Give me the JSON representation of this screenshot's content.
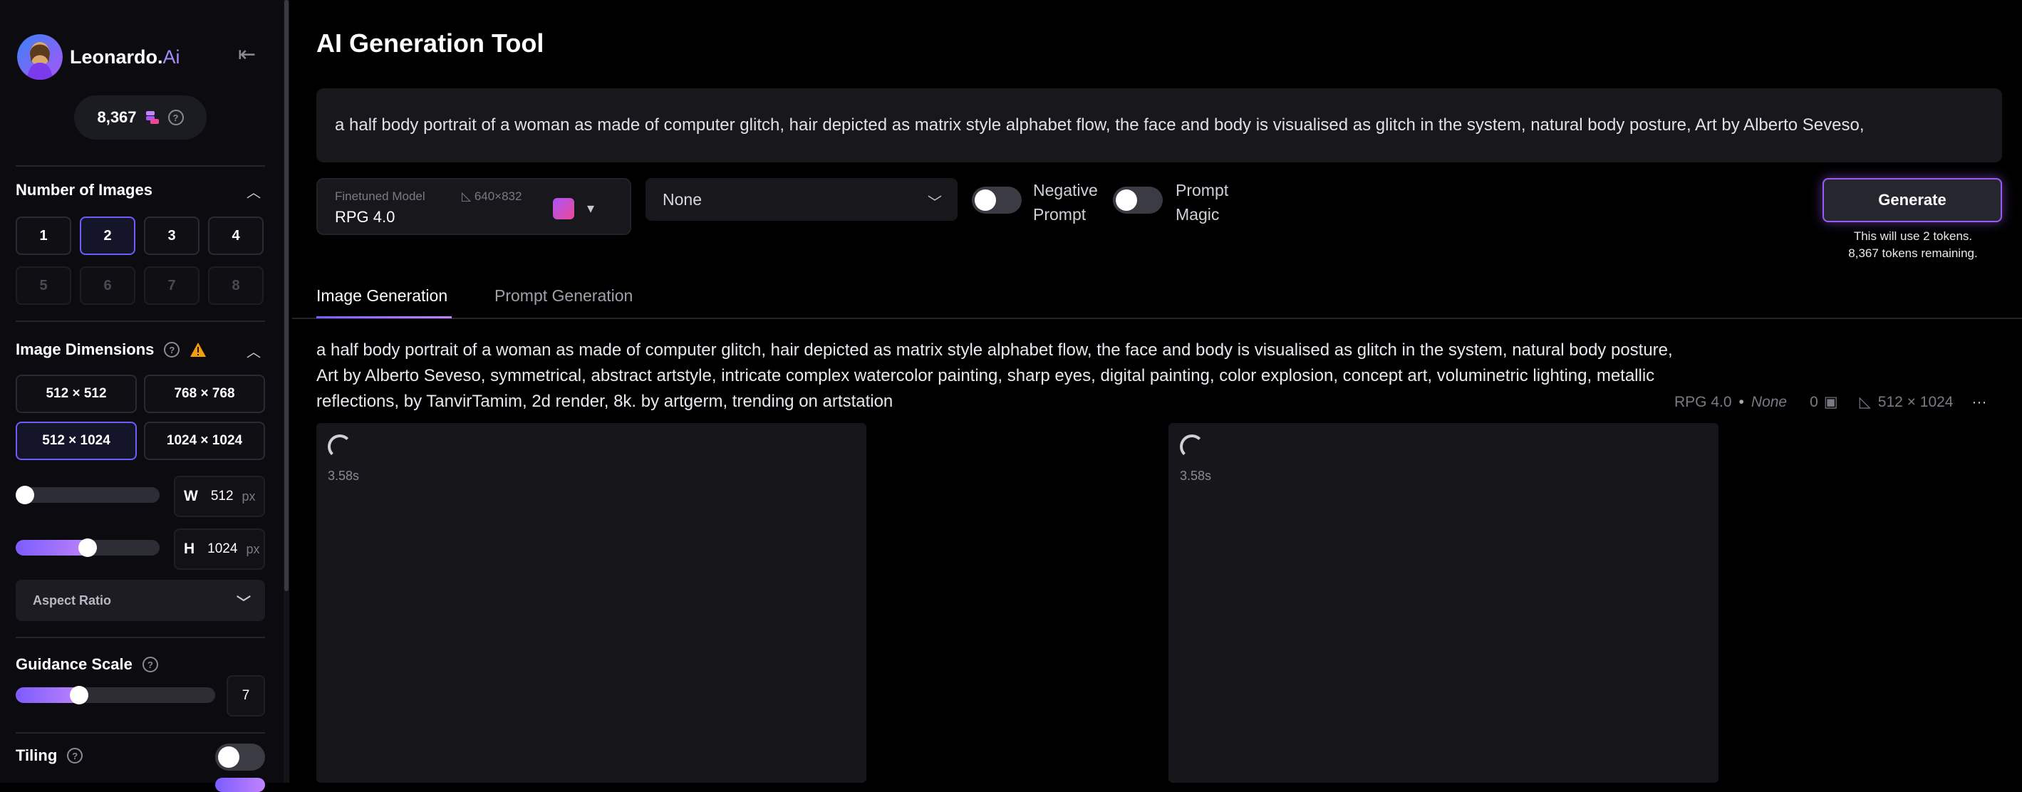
{
  "brand": {
    "name": "Leonardo.",
    "suffix": "Ai"
  },
  "sidebar": {
    "tokens": "8,367",
    "number_of_images": {
      "title": "Number of Images",
      "options": [
        "1",
        "2",
        "3",
        "4",
        "5",
        "6",
        "7",
        "8"
      ],
      "selected": "2"
    },
    "image_dimensions": {
      "title": "Image Dimensions",
      "options": [
        "512 × 512",
        "768 × 768",
        "512 × 1024",
        "1024 × 1024"
      ],
      "selected": "512 × 1024",
      "width_label": "W",
      "width_value": "512",
      "width_unit": "px",
      "height_label": "H",
      "height_value": "1024",
      "height_unit": "px",
      "width_fraction": 0.0,
      "height_fraction": 0.5,
      "aspect_ratio_label": "Aspect Ratio"
    },
    "guidance_scale": {
      "title": "Guidance Scale",
      "value": "7",
      "fraction": 0.3
    },
    "tiling": {
      "title": "Tiling",
      "enabled": false
    }
  },
  "main": {
    "title": "AI Generation Tool",
    "prompt": "a half body portrait of a woman as made of computer glitch, hair depicted as matrix style alphabet flow, the face and body is visualised as glitch in the system, natural body posture, Art by Alberto Seveso,",
    "model": {
      "label": "Finetuned Model",
      "dims": "640×832",
      "value": "RPG 4.0"
    },
    "style": {
      "value": "None"
    },
    "negative_prompt": {
      "line1": "Negative",
      "line2": "Prompt",
      "enabled": false
    },
    "prompt_magic": {
      "line1": "Prompt",
      "line2": "Magic",
      "enabled": false
    },
    "generate": {
      "label": "Generate",
      "note1": "This will use 2 tokens.",
      "note2": "8,367 tokens remaining."
    },
    "tabs": [
      {
        "label": "Image Generation",
        "active": true
      },
      {
        "label": "Prompt Generation",
        "active": false
      }
    ],
    "generation": {
      "prompt": "a half body portrait of a woman as made of computer glitch, hair depicted as matrix style alphabet flow, the face and body is visualised as glitch in the system, natural body posture, Art by Alberto Seveso, symmetrical, abstract artstyle, intricate complex watercolor painting, sharp eyes, digital painting, color explosion, concept art, voluminetric lighting, metallic reflections, by TanvirTamim, 2d render, 8k. by artgerm, trending on artstation",
      "meta_model": "RPG 4.0",
      "meta_style": "None",
      "meta_count": "0",
      "meta_dims": "512 × 1024",
      "images": [
        {
          "elapsed": "3.58s"
        },
        {
          "elapsed": "3.58s"
        }
      ]
    }
  },
  "colors": {
    "accent": "#7c5cff",
    "accent2": "#c084fc",
    "bg": "#000000"
  }
}
